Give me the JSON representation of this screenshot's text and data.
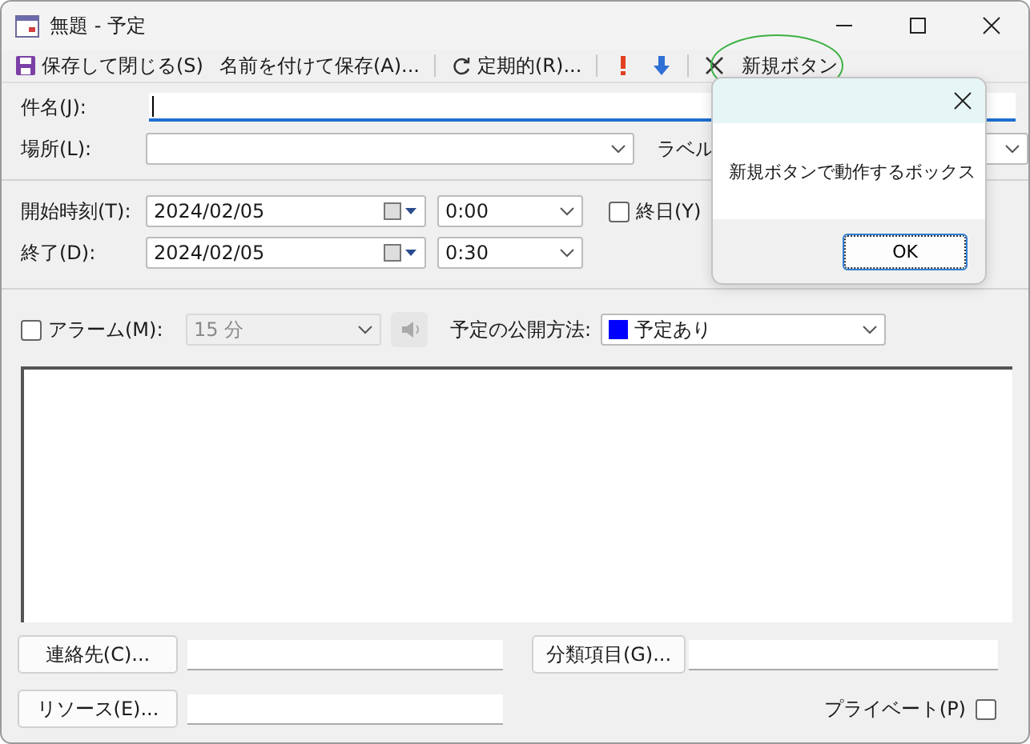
{
  "window": {
    "title": "無題 - 予定"
  },
  "toolbar": [
    {
      "kind": "save",
      "label": "保存して閉じる(S)"
    },
    {
      "kind": "plain",
      "label": "名前を付けて保存(A)..."
    },
    {
      "kind": "separator"
    },
    {
      "kind": "recur",
      "label": "定期的(R)..."
    },
    {
      "kind": "separator"
    },
    {
      "kind": "exclaim"
    },
    {
      "kind": "down"
    },
    {
      "kind": "separator"
    },
    {
      "kind": "delete"
    },
    {
      "kind": "plain",
      "label": "新規ボタン",
      "circled": true
    }
  ],
  "subject": {
    "label": "件名(J):",
    "focused": true
  },
  "location": {
    "label": "場所(L):"
  },
  "label_field": {
    "label": "ラベル"
  },
  "start": {
    "label": "開始時刻(T):",
    "date": "2024/02/05",
    "time": "0:00"
  },
  "end": {
    "label": "終了(D):",
    "date": "2024/02/05",
    "time": "0:30"
  },
  "all_day": {
    "label": "終日(Y)",
    "checked": false
  },
  "alarm": {
    "label": "アラーム(M):",
    "checked": false,
    "value": "15 分",
    "disabled": true
  },
  "show_as": {
    "label": "予定の公開方法:",
    "value": "予定あり",
    "color": "#0000ff"
  },
  "buttons": [
    {
      "label": "連絡先(C)..."
    },
    {
      "label": "分類項目(G)..."
    },
    {
      "label": "リソース(E)..."
    }
  ],
  "private": {
    "label": "プライベート(P)",
    "checked": false
  },
  "dialog": {
    "message": "新規ボタンで動作するボックス",
    "button": "OK"
  }
}
